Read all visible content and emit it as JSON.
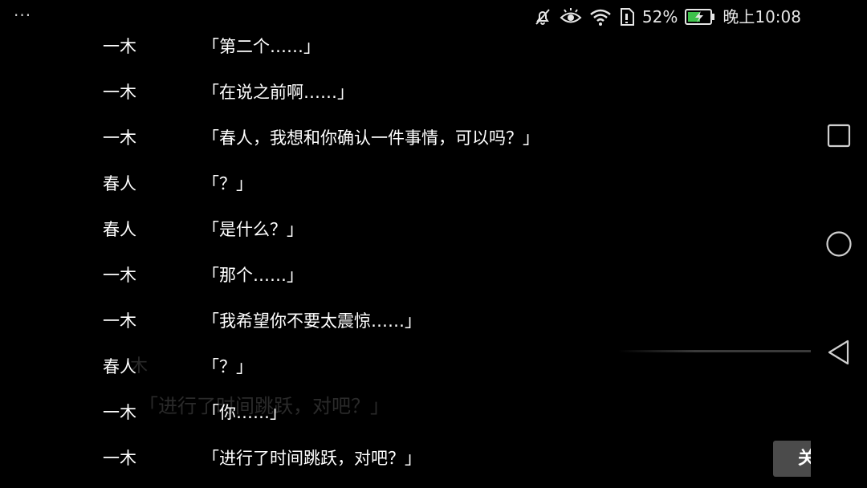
{
  "status_bar": {
    "menu_glyph": "···",
    "battery_percent": "52%",
    "time": "晚上10:08",
    "icons": [
      "muted-bell-icon",
      "eye-comfort-icon",
      "wifi-icon",
      "sim-card-icon",
      "battery-charging-icon"
    ],
    "battery_color": "#3ec24b"
  },
  "dialogue": [
    {
      "speaker": "一木",
      "text": "「第二个……」"
    },
    {
      "speaker": "一木",
      "text": "「在说之前啊……」"
    },
    {
      "speaker": "一木",
      "text": "「春人，我想和你确认一件事情，可以吗？」"
    },
    {
      "speaker": "春人",
      "text": "「？」"
    },
    {
      "speaker": "春人",
      "text": "「是什么？」"
    },
    {
      "speaker": "一木",
      "text": "「那个……」"
    },
    {
      "speaker": "一木",
      "text": "「我希望你不要太震惊……」"
    },
    {
      "speaker": "春人",
      "text": "「？」"
    },
    {
      "speaker": "一木",
      "text": "「你……」"
    },
    {
      "speaker": "一木",
      "text": "「进行了时间跳跃，对吧？」"
    }
  ],
  "background": {
    "speaker": "木",
    "text": "「进行了时间跳跃，对吧？」"
  },
  "close_button": {
    "label": "关"
  },
  "nav_bar": {
    "icons": [
      "recents-square-icon",
      "home-circle-icon",
      "back-triangle-icon"
    ]
  }
}
